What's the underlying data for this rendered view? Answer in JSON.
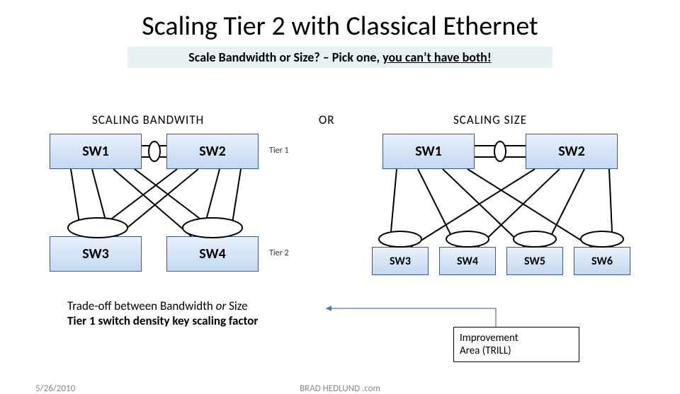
{
  "title": "Scaling Tier 2 with Classical Ethernet",
  "subtitle_a": "Scale Bandwidth or Size? – Pick one, ",
  "subtitle_b": "you can’t have both!",
  "labels": {
    "scaling_bw": "SCALING BANDWITH",
    "or": "OR",
    "scaling_size": "SCALING SIZE",
    "tier1": "Tier 1",
    "tier2": "Tier 2"
  },
  "left": {
    "sw1": "SW1",
    "sw2": "SW2",
    "sw3": "SW3",
    "sw4": "SW4"
  },
  "right": {
    "sw1": "SW1",
    "sw2": "SW2",
    "sw3": "SW3",
    "sw4": "SW4",
    "sw5": "SW5",
    "sw6": "SW6"
  },
  "tradeoff": {
    "line1a": "Trade-off between Bandwidth ",
    "line1b": "or ",
    "line1c": "Size",
    "line2": "Tier 1 switch density key scaling factor"
  },
  "improve_l1": "Improvement",
  "improve_l2": "Area (TRILL)",
  "footer": {
    "date": "5/26/2010",
    "brand": "BRAD HEDLUND .com"
  }
}
